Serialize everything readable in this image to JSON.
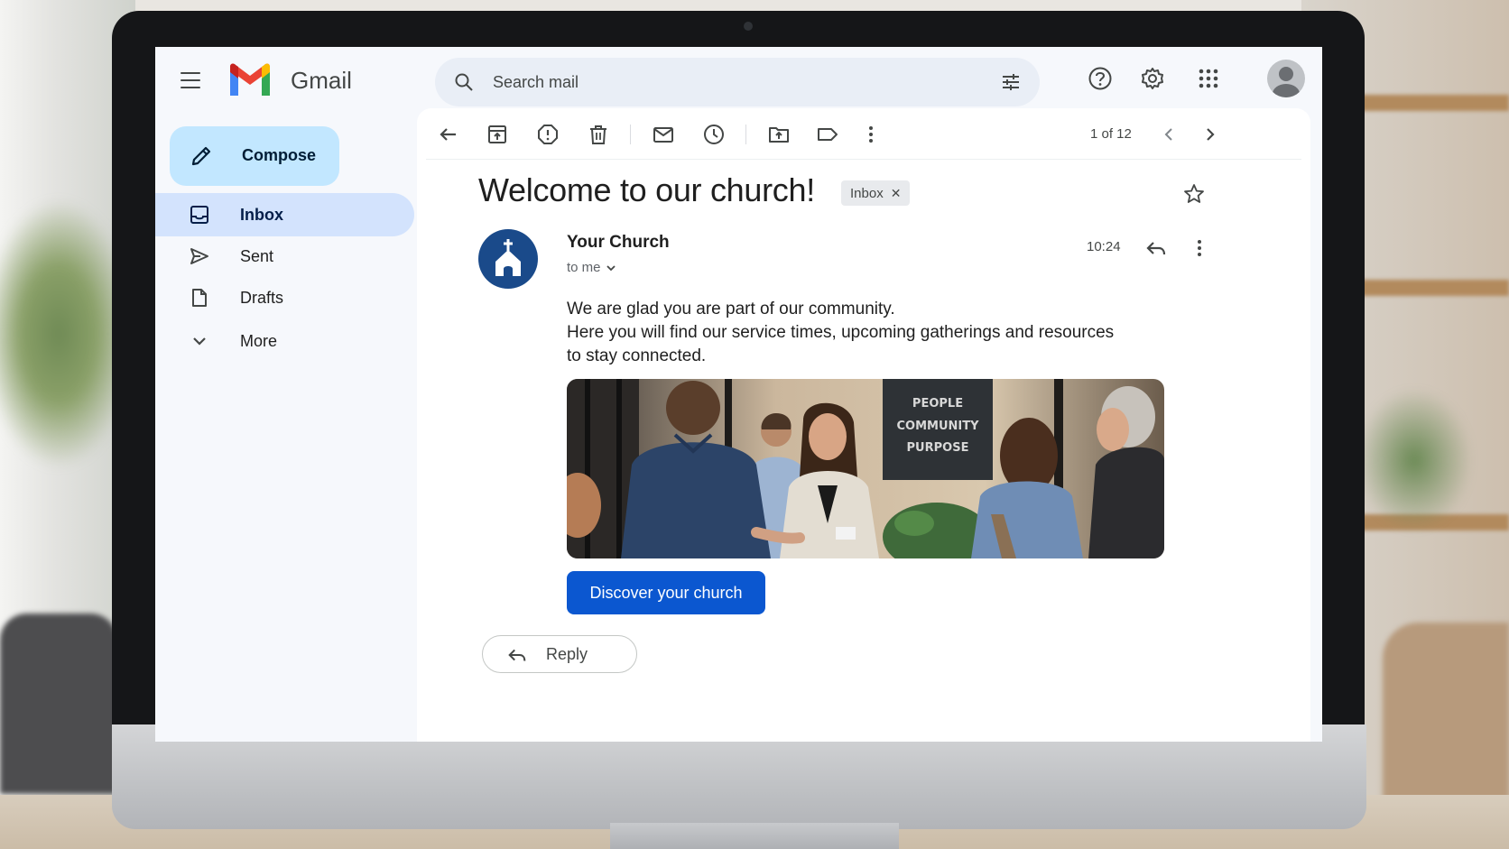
{
  "app": {
    "name": "Gmail"
  },
  "search": {
    "placeholder": "Search mail"
  },
  "sidebar": {
    "compose_label": "Compose",
    "items": [
      {
        "label": "Inbox",
        "icon": "inbox-icon",
        "active": true
      },
      {
        "label": "Sent",
        "icon": "send-icon"
      },
      {
        "label": "Drafts",
        "icon": "draft-icon"
      },
      {
        "label": "More",
        "icon": "chevron-down-icon"
      }
    ]
  },
  "toolbar": {
    "pager": "1 of 12"
  },
  "email": {
    "subject": "Welcome to our church!",
    "label_chip": "Inbox",
    "sender": "Your Church",
    "recipient": "to me",
    "time": "10:24",
    "body": [
      "We are glad you are part of our community.",
      "Here you will find our service times, upcoming gatherings and resources",
      "to stay connected."
    ],
    "image_sign": [
      "PEOPLE",
      "COMMUNITY",
      "PURPOSE"
    ],
    "cta_label": "Discover your church",
    "reply_label": "Reply"
  },
  "colors": {
    "compose_bg": "#c2e7ff",
    "active_nav_bg": "#d3e3fd",
    "cta_bg": "#0b57d0",
    "sender_avatar_bg": "#1a4a8a"
  }
}
